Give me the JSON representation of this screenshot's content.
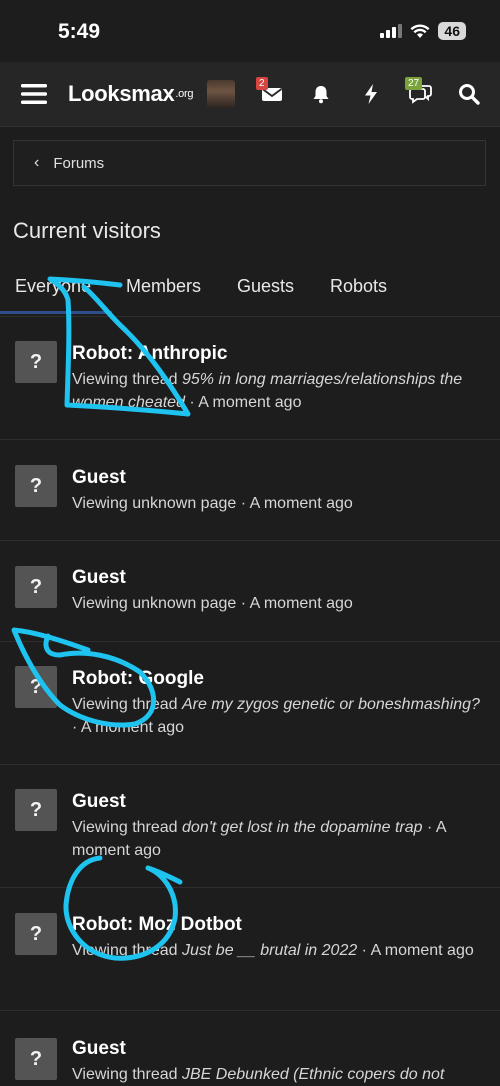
{
  "status_bar": {
    "time": "5:49",
    "battery": "46"
  },
  "navbar": {
    "logo": "Looksmax",
    "logo_suffix": ".org",
    "inbox_count": "2",
    "alerts_count": "27"
  },
  "breadcrumb": {
    "label": "Forums"
  },
  "page_title": "Current visitors",
  "tabs": [
    "Everyone",
    "Members",
    "Guests",
    "Robots"
  ],
  "visitors": [
    {
      "name": "Robot: Anthropic",
      "prefix": "Viewing thread ",
      "thread": "95% in long marriages/relationships the women cheated",
      "time": " · A moment ago"
    },
    {
      "name": "Guest",
      "prefix": "Viewing unknown page",
      "thread": "",
      "time": " · A moment ago"
    },
    {
      "name": "Guest",
      "prefix": "Viewing unknown page",
      "thread": "",
      "time": " · A moment ago"
    },
    {
      "name": "Robot: Google",
      "prefix": "Viewing thread ",
      "thread": "Are my zygos genetic or boneshmashing?",
      "time": " · A moment ago"
    },
    {
      "name": "Guest",
      "prefix": "Viewing thread ",
      "thread": "don't get lost in the dopamine trap",
      "time": " · A moment ago"
    },
    {
      "name": "Robot: Moz Dotbot",
      "prefix": "Viewing thread ",
      "thread": "Just be __ brutal in 2022",
      "time": " · A moment ago"
    },
    {
      "name": "Guest",
      "prefix": "Viewing thread ",
      "thread": "JBE Debunked (Ethnic copers do not",
      "time": ""
    }
  ],
  "colors": {
    "accent_annotation": "#1ec3f0",
    "tab_active": "#2d4f8c",
    "badge_inbox": "#d64541",
    "badge_alerts": "#7ba33c"
  }
}
